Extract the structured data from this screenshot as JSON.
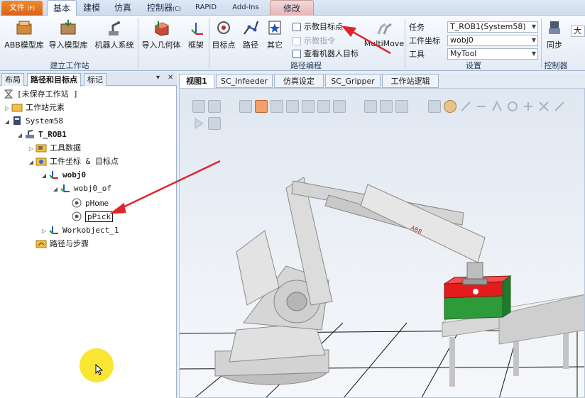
{
  "menu": {
    "file": "文件",
    "file_key": "(F)",
    "tabs": [
      "基本",
      "建模",
      "仿真",
      "控制器",
      "RAPID",
      "Add-Ins",
      "修改"
    ],
    "controller_key": "(C)"
  },
  "ribbon": {
    "buttons": {
      "abb_library": "ABB模型库",
      "import_library": "导入模型库",
      "robot_system": "机器人系统",
      "import_geometry": "导入几何体",
      "frame": "框架",
      "target": "目标点",
      "path": "路径",
      "other": "其它",
      "teach_target": "示教目标点",
      "teach_instruction": "示教指令",
      "view_robot_target": "查看机器人目标",
      "multimove": "MultiMove",
      "sync": "同步",
      "big": "大地"
    },
    "groups": {
      "build_station": "建立工作站",
      "path_programming": "路径编程",
      "settings": "设置",
      "controller": "控制器"
    },
    "fields": {
      "task_label": "任务",
      "task_value": "T_ROB1(System58)",
      "wobj_label": "工件坐标",
      "wobj_value": "wobj0",
      "tool_label": "工具",
      "tool_value": "MyTool"
    }
  },
  "left_panel": {
    "tabs": [
      "布局",
      "路径和目标点",
      "标记"
    ],
    "tree": {
      "station": "[未保存工作站 ]",
      "station_elements": "工作站元素",
      "system": "System58",
      "robot": "T_ROB1",
      "tool_data": "工具数据",
      "wobj_targets": "工件坐标 & 目标点",
      "wobj0": "wobj0",
      "wobj0_of": "wobj0_of",
      "phome": "pHome",
      "ppick": "pPick",
      "workobject1": "Workobject_1",
      "paths_procedures": "路径与步骤"
    }
  },
  "viewport": {
    "tabs": [
      "视图1",
      "SC_Infeeder",
      "仿真设定",
      "SC_Gripper",
      "工作站逻辑"
    ]
  },
  "colors": {
    "accent_orange": "#e8771f",
    "annotation_red": "#e0262b",
    "box_red": "#e21c1c",
    "box_green": "#2e9b3a",
    "cursor_highlight": "#f7e31d"
  }
}
